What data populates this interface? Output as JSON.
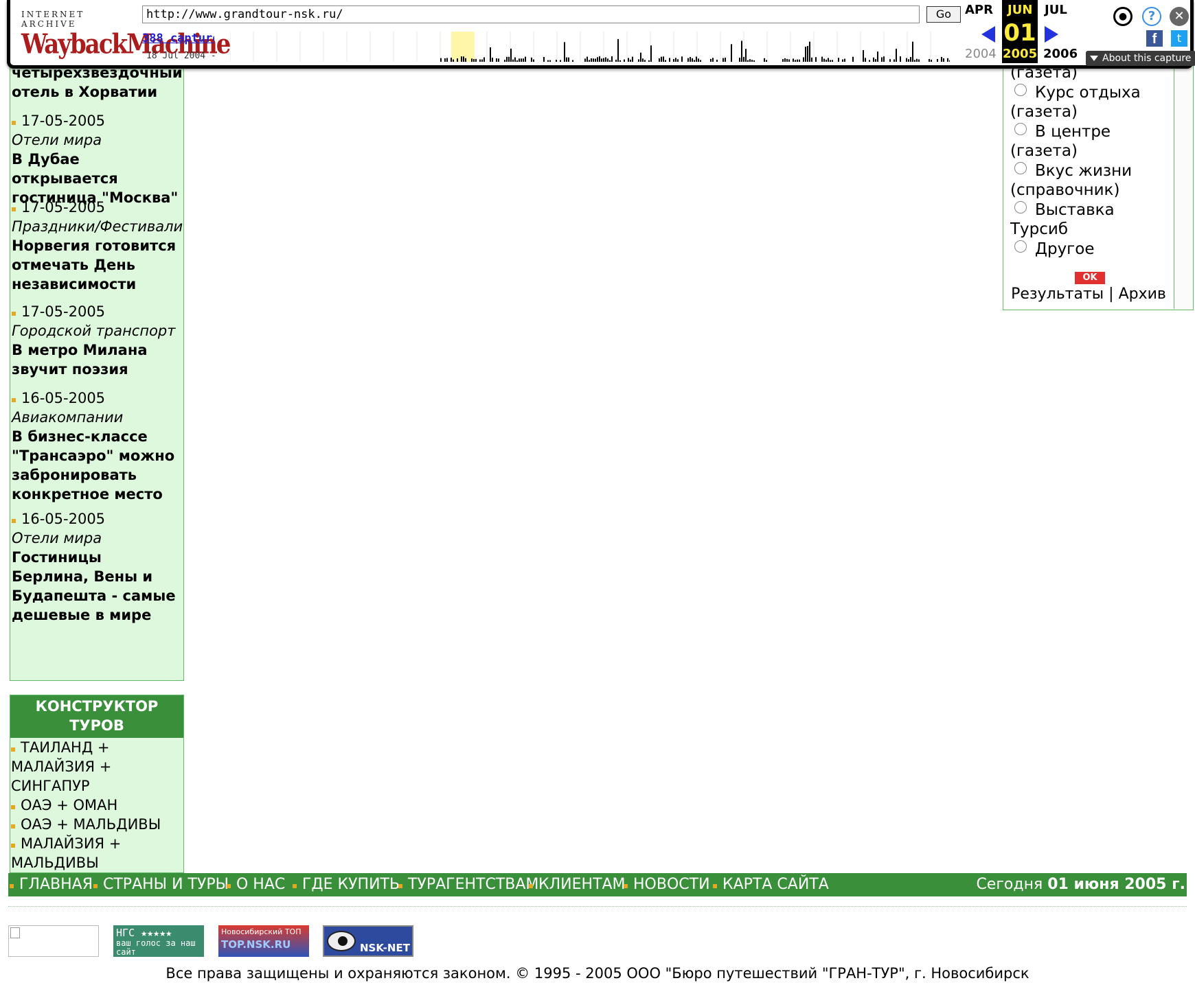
{
  "wayback": {
    "logo_top": "INTERNET ARCHIVE",
    "logo_main": "WaybackMachine",
    "url": "http://www.grandtour-nsk.ru/",
    "go_label": "Go",
    "captures_label": "388 captures",
    "range_label": "18 Jul 2004 - 1",
    "months": {
      "prev": "APR",
      "current": "JUN",
      "next": "JUL"
    },
    "day": "01",
    "years": {
      "prev": "2004",
      "current": "2005",
      "next": "2006"
    },
    "about_label": "About this capture",
    "icons": [
      "user-icon",
      "help-icon",
      "close-icon",
      "facebook-icon",
      "twitter-icon"
    ]
  },
  "news": [
    {
      "date": "",
      "category": "",
      "title": "четырехзвездочный отель в Хорватии"
    },
    {
      "date": "17-05-2005",
      "category": "Отели мира",
      "title": "В Дубае открывается гостиница \"Москва\""
    },
    {
      "date": "17-05-2005",
      "category": "Праздники/Фестивали",
      "title": "Норвегия готовится отмечать День независимости"
    },
    {
      "date": "17-05-2005",
      "category": "Городской транспорт",
      "title": "В метро Милана звучит поэзия"
    },
    {
      "date": "16-05-2005",
      "category": "Авиакомпании",
      "title": "В бизнес-классе \"Трансаэро\" можно забронировать конкретное место"
    },
    {
      "date": "16-05-2005",
      "category": "Отели мира",
      "title": "Гостиницы Берлина, Вены и Будапешта - самые дешевые в мире"
    }
  ],
  "tours": {
    "header": "КОНСТРУКТОР ТУРОВ",
    "items": [
      "ТАИЛАНД + МАЛАЙЗИЯ + СИНГАПУР",
      "ОАЭ + ОМАН",
      "ОАЭ + МАЛЬДИВЫ",
      "МАЛАЙЗИЯ + МАЛЬДИВЫ"
    ]
  },
  "poll": {
    "lines": [
      {
        "radio": false,
        "text": "(газета)"
      },
      {
        "radio": true,
        "text": "Курс отдыха"
      },
      {
        "radio": false,
        "text": "(газета)"
      },
      {
        "radio": true,
        "text": "В центре"
      },
      {
        "radio": false,
        "text": "(газета)"
      },
      {
        "radio": true,
        "text": "Вкус жизни"
      },
      {
        "radio": false,
        "text": "(справочник)"
      },
      {
        "radio": true,
        "text": "Выставка"
      },
      {
        "radio": false,
        "text": "Турсиб"
      },
      {
        "radio": true,
        "text": "Другое"
      }
    ],
    "ok_label": "OK",
    "results_label": "Результаты",
    "separator": "|",
    "archive_label": "Архив"
  },
  "nav": {
    "items": [
      "ГЛАВНАЯ",
      "СТРАНЫ И ТУРЫ",
      "О НАС",
      "ГДЕ КУПИТЬ",
      "ТУРАГЕНТСТВАМ",
      "КЛИЕНТАМ",
      "НОВОСТИ",
      "КАРТА САЙТА"
    ],
    "today_prefix": "Сегодня",
    "today_date": "01 июня 2005 г."
  },
  "banners": {
    "ngs_line1": "НГС ★★★★★",
    "ngs_line2": "ваш голос за наш сайт",
    "top_line1": "Новосибирский ТОП",
    "top_line2": "TOP.NSK.RU",
    "nsk_label": "NSK-NET"
  },
  "copyright": "Все права защищены и охраняются законом. © 1995 - 2005 ООО \"Бюро путешествий \"ГРАН-ТУР\", г. Новосибирск",
  "colors": {
    "green_dark": "#3a8f3a",
    "green_light": "#ddf8dd",
    "bullet": "#e5a823",
    "wb_highlight": "#ffeb3b",
    "wb_arrow": "#2233dd"
  }
}
